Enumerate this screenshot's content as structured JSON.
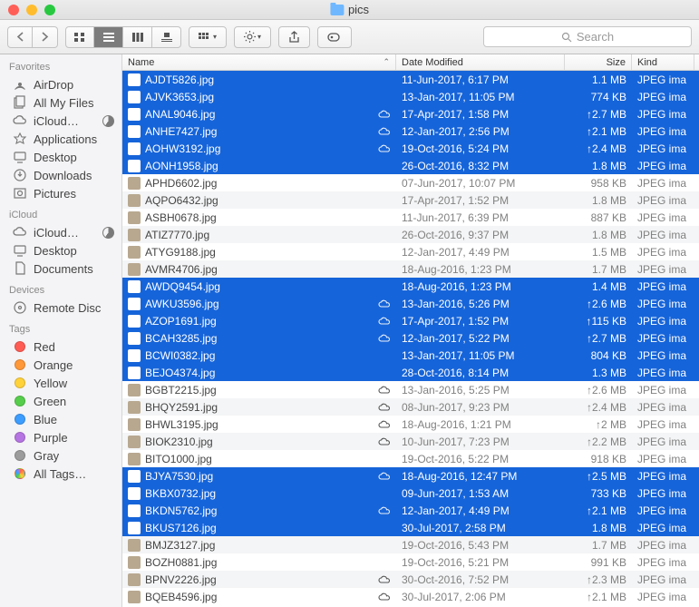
{
  "window": {
    "title": "pics"
  },
  "search": {
    "placeholder": "Search"
  },
  "columns": {
    "name": "Name",
    "date": "Date Modified",
    "size": "Size",
    "kind": "Kind"
  },
  "sidebar": {
    "favorites": {
      "label": "Favorites",
      "items": [
        {
          "label": "AirDrop",
          "icon": "airdrop"
        },
        {
          "label": "All My Files",
          "icon": "files"
        },
        {
          "label": "iCloud…",
          "icon": "cloud",
          "pie": true
        },
        {
          "label": "Applications",
          "icon": "apps"
        },
        {
          "label": "Desktop",
          "icon": "desktop"
        },
        {
          "label": "Downloads",
          "icon": "downloads"
        },
        {
          "label": "Pictures",
          "icon": "pictures"
        }
      ]
    },
    "icloud": {
      "label": "iCloud",
      "items": [
        {
          "label": "iCloud…",
          "icon": "cloud",
          "pie": true
        },
        {
          "label": "Desktop",
          "icon": "desktop"
        },
        {
          "label": "Documents",
          "icon": "documents"
        }
      ]
    },
    "devices": {
      "label": "Devices",
      "items": [
        {
          "label": "Remote Disc",
          "icon": "disc"
        }
      ]
    },
    "tags": {
      "label": "Tags",
      "items": [
        {
          "label": "Red",
          "color": "#ff5c54"
        },
        {
          "label": "Orange",
          "color": "#ff9838"
        },
        {
          "label": "Yellow",
          "color": "#ffd23a"
        },
        {
          "label": "Green",
          "color": "#56ce4c"
        },
        {
          "label": "Blue",
          "color": "#3d9dff"
        },
        {
          "label": "Purple",
          "color": "#b574e2"
        },
        {
          "label": "Gray",
          "color": "#9c9c9c"
        },
        {
          "label": "All Tags…",
          "color": "multi"
        }
      ]
    }
  },
  "files": [
    {
      "name": "AJDT5826.jpg",
      "date": "11-Jun-2017, 6:17 PM",
      "size": "1.1 MB",
      "kind": "JPEG ima",
      "sel": true
    },
    {
      "name": "AJVK3653.jpg",
      "date": "13-Jan-2017, 11:05 PM",
      "size": "774 KB",
      "kind": "JPEG ima",
      "sel": true
    },
    {
      "name": "ANAL9046.jpg",
      "date": "17-Apr-2017, 1:58 PM",
      "size": "2.7 MB",
      "kind": "JPEG ima",
      "sel": true,
      "cloud": true,
      "up": true
    },
    {
      "name": "ANHE7427.jpg",
      "date": "12-Jan-2017, 2:56 PM",
      "size": "2.1 MB",
      "kind": "JPEG ima",
      "sel": true,
      "cloud": true,
      "up": true
    },
    {
      "name": "AOHW3192.jpg",
      "date": "19-Oct-2016, 5:24 PM",
      "size": "2.4 MB",
      "kind": "JPEG ima",
      "sel": true,
      "cloud": true,
      "up": true
    },
    {
      "name": "AONH1958.jpg",
      "date": "26-Oct-2016, 8:32 PM",
      "size": "1.8 MB",
      "kind": "JPEG ima",
      "sel": true
    },
    {
      "name": "APHD6602.jpg",
      "date": "07-Jun-2017, 10:07 PM",
      "size": "958 KB",
      "kind": "JPEG ima"
    },
    {
      "name": "AQPO6432.jpg",
      "date": "17-Apr-2017, 1:52 PM",
      "size": "1.8 MB",
      "kind": "JPEG ima"
    },
    {
      "name": "ASBH0678.jpg",
      "date": "11-Jun-2017, 6:39 PM",
      "size": "887 KB",
      "kind": "JPEG ima"
    },
    {
      "name": "ATIZ7770.jpg",
      "date": "26-Oct-2016, 9:37 PM",
      "size": "1.8 MB",
      "kind": "JPEG ima"
    },
    {
      "name": "ATYG9188.jpg",
      "date": "12-Jan-2017, 4:49 PM",
      "size": "1.5 MB",
      "kind": "JPEG ima"
    },
    {
      "name": "AVMR4706.jpg",
      "date": "18-Aug-2016, 1:23 PM",
      "size": "1.7 MB",
      "kind": "JPEG ima"
    },
    {
      "name": "AWDQ9454.jpg",
      "date": "18-Aug-2016, 1:23 PM",
      "size": "1.4 MB",
      "kind": "JPEG ima",
      "sel": true
    },
    {
      "name": "AWKU3596.jpg",
      "date": "13-Jan-2016, 5:26 PM",
      "size": "2.6 MB",
      "kind": "JPEG ima",
      "sel": true,
      "cloud": true,
      "up": true
    },
    {
      "name": "AZOP1691.jpg",
      "date": "17-Apr-2017, 1:52 PM",
      "size": "115 KB",
      "kind": "JPEG ima",
      "sel": true,
      "cloud": true,
      "up": true
    },
    {
      "name": "BCAH3285.jpg",
      "date": "12-Jan-2017, 5:22 PM",
      "size": "2.7 MB",
      "kind": "JPEG ima",
      "sel": true,
      "cloud": true,
      "up": true
    },
    {
      "name": "BCWI0382.jpg",
      "date": "13-Jan-2017, 11:05 PM",
      "size": "804 KB",
      "kind": "JPEG ima",
      "sel": true
    },
    {
      "name": "BEJO4374.jpg",
      "date": "28-Oct-2016, 8:14 PM",
      "size": "1.3 MB",
      "kind": "JPEG ima",
      "sel": true
    },
    {
      "name": "BGBT2215.jpg",
      "date": "13-Jan-2016, 5:25 PM",
      "size": "2.6 MB",
      "kind": "JPEG ima",
      "cloud": true,
      "up": true
    },
    {
      "name": "BHQY2591.jpg",
      "date": "08-Jun-2017, 9:23 PM",
      "size": "2.4 MB",
      "kind": "JPEG ima",
      "cloud": true,
      "up": true
    },
    {
      "name": "BHWL3195.jpg",
      "date": "18-Aug-2016, 1:21 PM",
      "size": "2 MB",
      "kind": "JPEG ima",
      "cloud": true,
      "up": true
    },
    {
      "name": "BIOK2310.jpg",
      "date": "10-Jun-2017, 7:23 PM",
      "size": "2.2 MB",
      "kind": "JPEG ima",
      "cloud": true,
      "up": true
    },
    {
      "name": "BITO1000.jpg",
      "date": "19-Oct-2016, 5:22 PM",
      "size": "918 KB",
      "kind": "JPEG ima"
    },
    {
      "name": "BJYA7530.jpg",
      "date": "18-Aug-2016, 12:47 PM",
      "size": "2.5 MB",
      "kind": "JPEG ima",
      "sel": true,
      "cloud": true,
      "up": true
    },
    {
      "name": "BKBX0732.jpg",
      "date": "09-Jun-2017, 1:53 AM",
      "size": "733 KB",
      "kind": "JPEG ima",
      "sel": true
    },
    {
      "name": "BKDN5762.jpg",
      "date": "12-Jan-2017, 4:49 PM",
      "size": "2.1 MB",
      "kind": "JPEG ima",
      "sel": true,
      "cloud": true,
      "up": true
    },
    {
      "name": "BKUS7126.jpg",
      "date": "30-Jul-2017, 2:58 PM",
      "size": "1.8 MB",
      "kind": "JPEG ima",
      "sel": true
    },
    {
      "name": "BMJZ3127.jpg",
      "date": "19-Oct-2016, 5:43 PM",
      "size": "1.7 MB",
      "kind": "JPEG ima"
    },
    {
      "name": "BOZH0881.jpg",
      "date": "19-Oct-2016, 5:21 PM",
      "size": "991 KB",
      "kind": "JPEG ima"
    },
    {
      "name": "BPNV2226.jpg",
      "date": "30-Oct-2016, 7:52 PM",
      "size": "2.3 MB",
      "kind": "JPEG ima",
      "cloud": true,
      "up": true
    },
    {
      "name": "BQEB4596.jpg",
      "date": "30-Jul-2017, 2:06 PM",
      "size": "2.1 MB",
      "kind": "JPEG ima",
      "cloud": true,
      "up": true
    }
  ]
}
